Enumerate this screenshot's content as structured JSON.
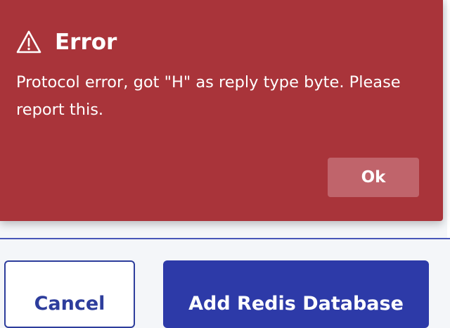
{
  "error_toast": {
    "icon": "warning-triangle-icon",
    "title": "Error",
    "message": "Protocol error, got \"H\" as reply type byte. Please report this.",
    "ok_label": "Ok"
  },
  "footer": {
    "cancel_label": "Cancel",
    "add_label": "Add Redis Database"
  },
  "colors": {
    "toast_background": "#a9343a",
    "ok_button": "#c0646b",
    "primary": "#2d3aa8",
    "accent_border": "#2d3d9c"
  }
}
